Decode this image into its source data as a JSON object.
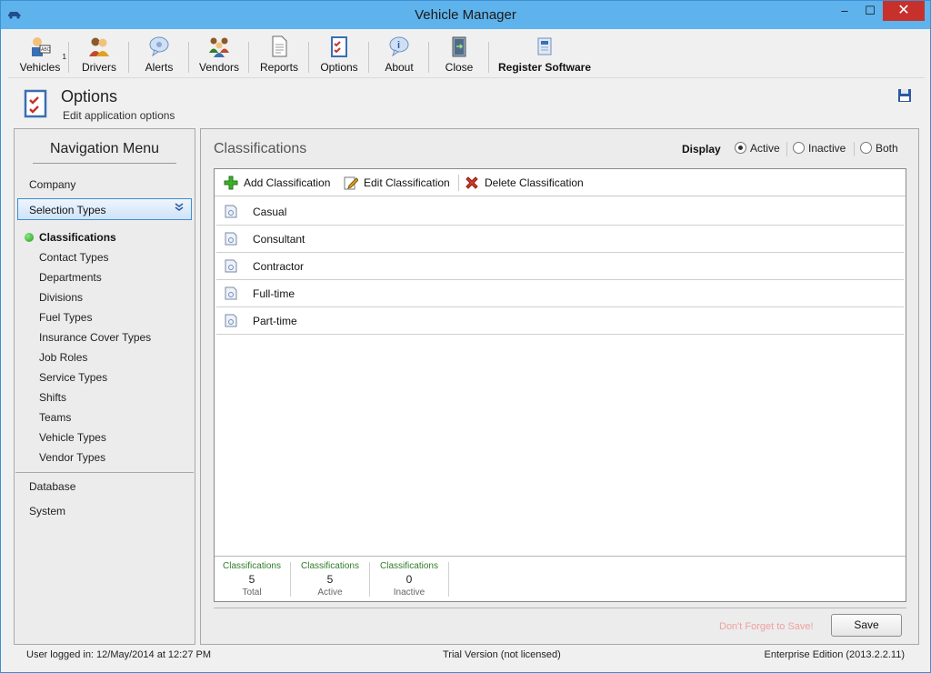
{
  "window": {
    "title": "Vehicle Manager",
    "min_glyph": "–",
    "max_glyph": "☐",
    "close_glyph": "✕"
  },
  "toolbar": {
    "items": [
      {
        "label": "Vehicles",
        "icon": "vehicles-icon",
        "badge": "1"
      },
      {
        "label": "Drivers",
        "icon": "drivers-icon"
      },
      {
        "label": "Alerts",
        "icon": "alerts-icon"
      },
      {
        "label": "Vendors",
        "icon": "vendors-icon"
      },
      {
        "label": "Reports",
        "icon": "reports-icon"
      },
      {
        "label": "Options",
        "icon": "options-icon"
      },
      {
        "label": "About",
        "icon": "about-icon"
      },
      {
        "label": "Close",
        "icon": "close-door-icon"
      },
      {
        "label": "Register Software",
        "icon": "register-icon"
      }
    ]
  },
  "header": {
    "title": "Options",
    "subtitle": "Edit application options"
  },
  "nav": {
    "title": "Navigation Menu",
    "company": "Company",
    "group": "Selection Types",
    "items": [
      "Classifications",
      "Contact Types",
      "Departments",
      "Divisions",
      "Fuel Types",
      "Insurance Cover Types",
      "Job Roles",
      "Service Types",
      "Shifts",
      "Teams",
      "Vehicle Types",
      "Vendor Types"
    ],
    "active_index": 0,
    "database": "Database",
    "system": "System"
  },
  "main": {
    "title": "Classifications",
    "display": {
      "label": "Display",
      "options": [
        "Active",
        "Inactive",
        "Both"
      ],
      "selected": "Active"
    },
    "actions": {
      "add": "Add Classification",
      "edit": "Edit Classification",
      "delete": "Delete Classification"
    },
    "rows": [
      "Casual",
      "Consultant",
      "Contractor",
      "Full-time",
      "Part-time"
    ],
    "stats": [
      {
        "title": "Classifications",
        "value": "5",
        "caption": "Total"
      },
      {
        "title": "Classifications",
        "value": "5",
        "caption": "Active"
      },
      {
        "title": "Classifications",
        "value": "0",
        "caption": "Inactive"
      }
    ],
    "reminder": "Don't Forget to Save!",
    "save_label": "Save"
  },
  "status": {
    "left": "User logged in:  12/May/2014 at 12:27 PM",
    "center": "Trial Version (not licensed)",
    "right": "Enterprise Edition (2013.2.2.11)"
  },
  "colors": {
    "accent": "#3d8ed4",
    "titlebar": "#5fb3ec",
    "close_red": "#c7312c",
    "stat_green": "#2f7d2a"
  }
}
